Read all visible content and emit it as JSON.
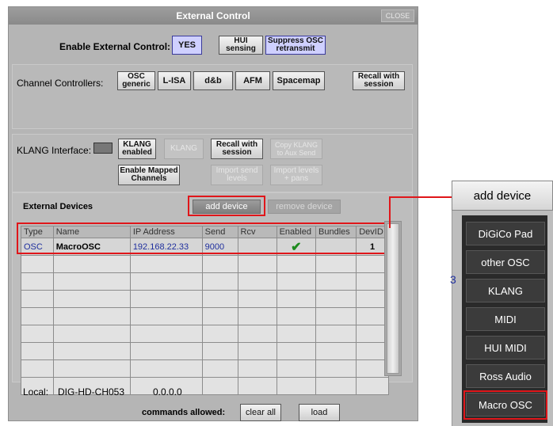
{
  "window": {
    "title": "External Control",
    "close_label": "CLOSE"
  },
  "enable": {
    "label": "Enable External Control:",
    "yes": "YES",
    "hui": "HUI sensing",
    "suppress": "Suppress OSC retransmit"
  },
  "channel_controllers": {
    "label": "Channel Controllers:",
    "buttons": [
      "OSC generic",
      "L-ISA",
      "d&b",
      "AFM",
      "Spacemap"
    ],
    "recall": "Recall with session"
  },
  "klang": {
    "label": "KLANG Interface:",
    "enabled": "KLANG enabled",
    "klang_dis": "KLANG",
    "recall": "Recall with session",
    "copy": "Copy KLANG to Aux Send",
    "enable_mapped": "Enable Mapped Channels",
    "import_send": "Import send levels",
    "import_pan": "Import levels + pans"
  },
  "devices": {
    "title": "External Devices",
    "add": "add device",
    "remove": "remove device",
    "columns": [
      "Type",
      "Name",
      "IP Address",
      "Send",
      "Rcv",
      "Enabled",
      "Bundles",
      "DevID"
    ],
    "rows": [
      {
        "type": "OSC",
        "name": "MacroOSC",
        "ip": "192.168.22.33",
        "send": "9000",
        "rcv": "",
        "enabled": "✔",
        "bundles": "",
        "devid": "1"
      }
    ]
  },
  "local": {
    "label": "Local:",
    "host": "DIG-HD-CH053",
    "ip": "0.0.0.0"
  },
  "commands": {
    "label": "commands allowed:",
    "clear": "clear all",
    "load": "load"
  },
  "popup": {
    "header": "add device",
    "partial_text": "3",
    "items": [
      "DiGiCo Pad",
      "other OSC",
      "KLANG",
      "MIDI",
      "HUI MIDI",
      "Ross Audio",
      "Macro OSC"
    ]
  },
  "colors": {
    "accent_red": "#e0161a",
    "link_blue": "#1f2f9e",
    "check_green": "#1d8a1d"
  }
}
